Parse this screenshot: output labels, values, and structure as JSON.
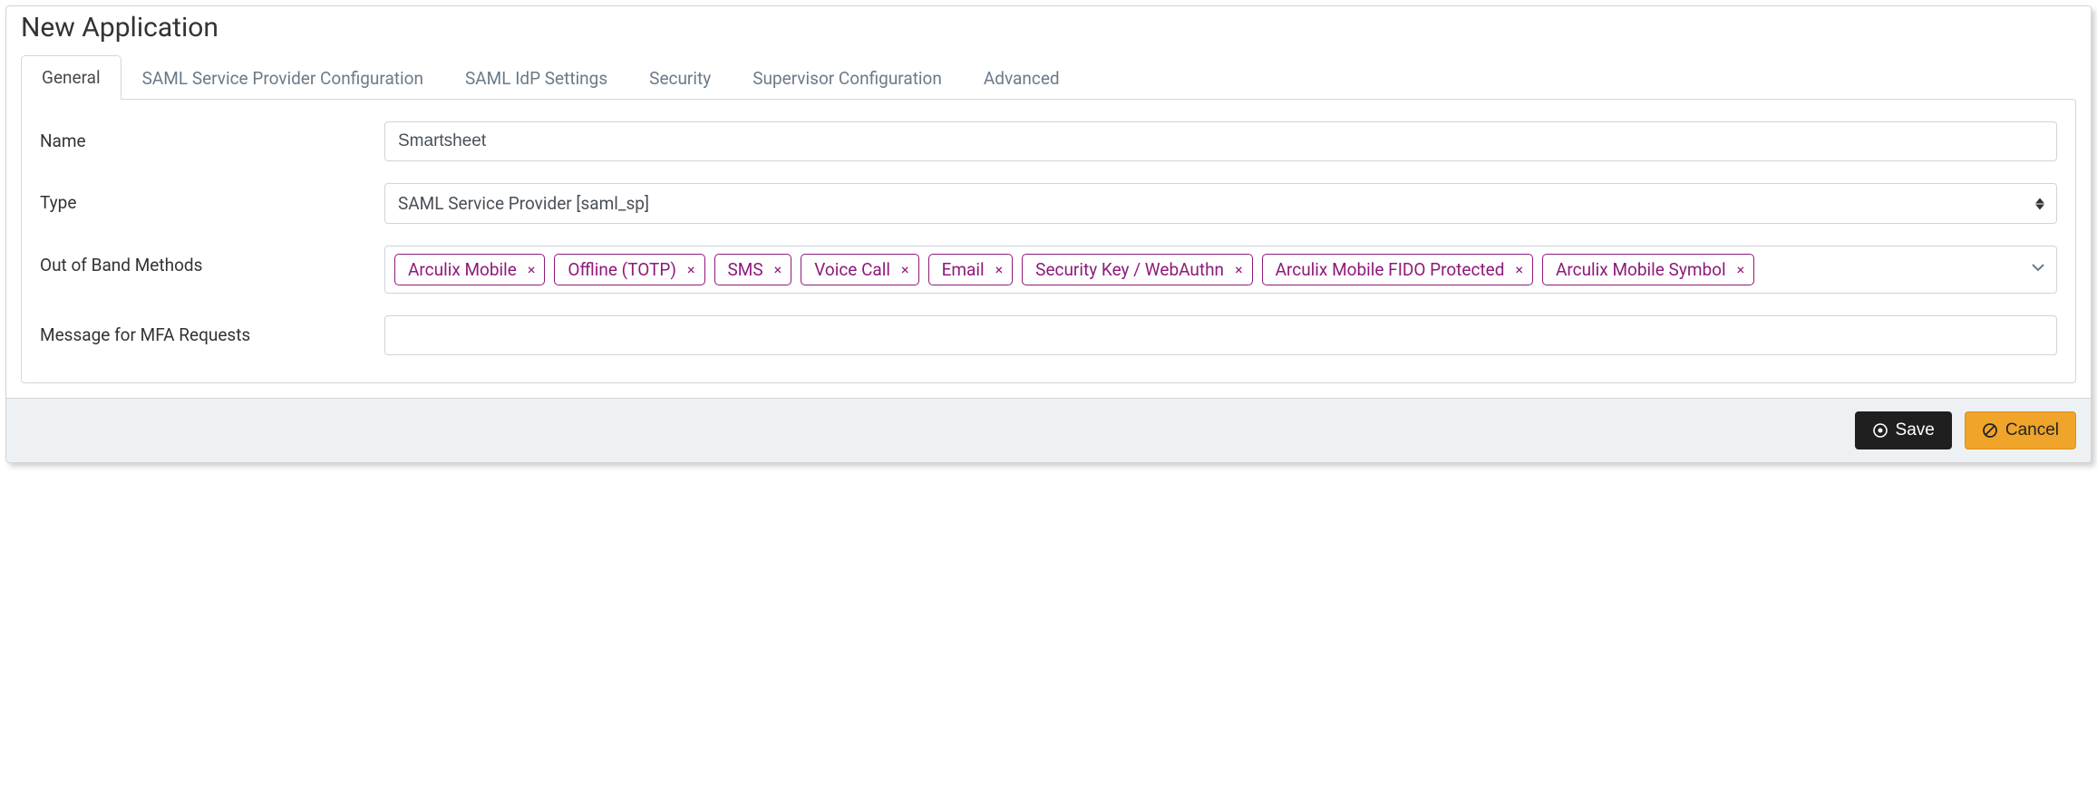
{
  "title": "New Application",
  "tabs": [
    {
      "label": "General",
      "active": true
    },
    {
      "label": "SAML Service Provider Configuration",
      "active": false
    },
    {
      "label": "SAML IdP Settings",
      "active": false
    },
    {
      "label": "Security",
      "active": false
    },
    {
      "label": "Supervisor Configuration",
      "active": false
    },
    {
      "label": "Advanced",
      "active": false
    }
  ],
  "form": {
    "name_label": "Name",
    "name_value": "Smartsheet",
    "type_label": "Type",
    "type_value": "SAML Service Provider [saml_sp]",
    "oob_label": "Out of Band Methods",
    "oob_tags": [
      "Arculix Mobile",
      "Offline (TOTP)",
      "SMS",
      "Voice Call",
      "Email",
      "Security Key / WebAuthn",
      "Arculix Mobile FIDO Protected",
      "Arculix Mobile Symbol"
    ],
    "mfa_label": "Message for MFA Requests",
    "mfa_value": ""
  },
  "footer": {
    "save_label": "Save",
    "cancel_label": "Cancel"
  }
}
